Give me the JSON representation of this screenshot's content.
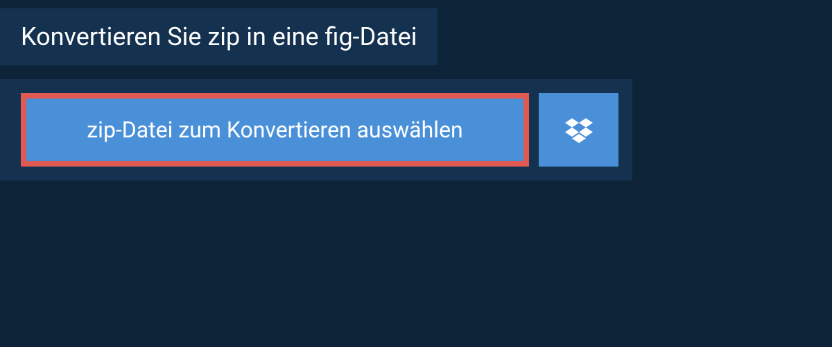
{
  "header": {
    "title": "Konvertieren Sie zip in eine fig-Datei"
  },
  "upload": {
    "select_file_label": "zip-Datei zum Konvertieren auswählen"
  },
  "colors": {
    "page_bg": "#0d2438",
    "panel_bg": "#153150",
    "button_bg": "#4a90d9",
    "highlight_border": "#e05a52",
    "text": "#ffffff"
  }
}
